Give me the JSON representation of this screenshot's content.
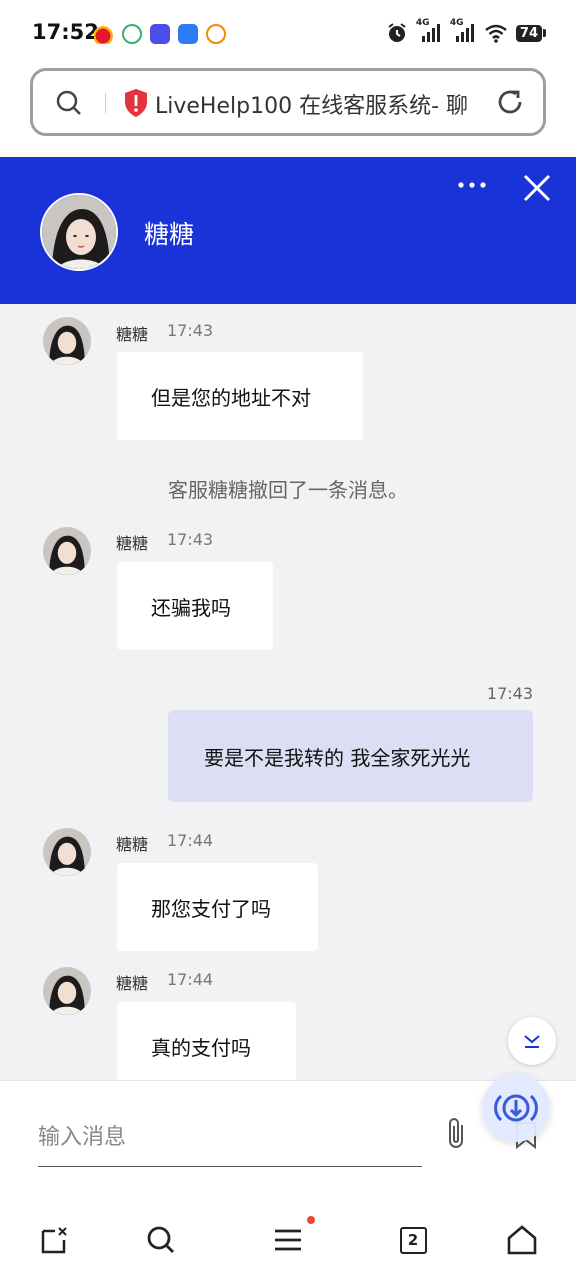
{
  "status_bar": {
    "time": "17:52",
    "battery": "74",
    "network_1": "4G",
    "network_2": "4G",
    "icons": [
      "weibo-icon",
      "app-icon",
      "app-icon",
      "app-icon",
      "app-icon",
      "alarm-icon",
      "signal-icon",
      "signal-icon",
      "wifi-icon",
      "battery-icon"
    ]
  },
  "browser": {
    "address_text": "LiveHelp100 在线客服系统- 聊"
  },
  "chat": {
    "agent_name": "糖糖",
    "messages": [
      {
        "sender": "糖糖",
        "time": "17:43",
        "text": "但是您的地址不对"
      },
      {
        "system": "客服糖糖撤回了一条消息。"
      },
      {
        "sender": "糖糖",
        "time": "17:43",
        "text": "还骗我吗"
      },
      {
        "mine": true,
        "time": "17:43",
        "text": "要是不是我转的 我全家死光光"
      },
      {
        "sender": "糖糖",
        "time": "17:44",
        "text": "那您支付了吗"
      },
      {
        "sender": "糖糖",
        "time": "17:44",
        "text": "真的支付吗"
      }
    ]
  },
  "input": {
    "placeholder": "输入消息"
  },
  "nav": {
    "tab_count": "2"
  },
  "colors": {
    "header_blue": "#1933d8",
    "my_bubble": "#dcdff4",
    "chat_bg": "#f2f2f4",
    "fab_icon": "#3a5bd9"
  }
}
